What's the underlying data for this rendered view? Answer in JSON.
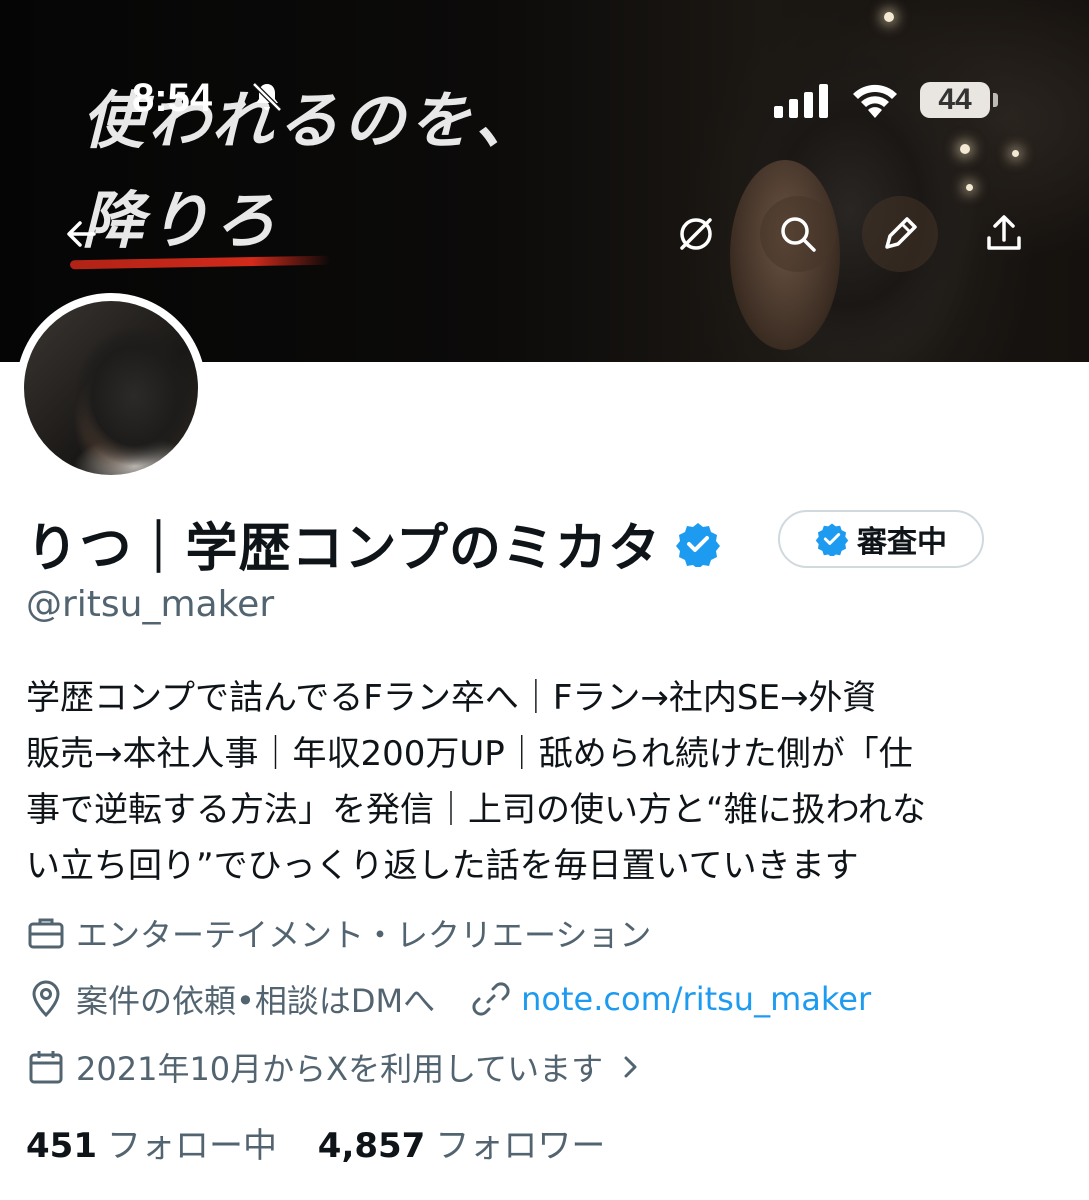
{
  "status_bar": {
    "time": "8:54",
    "battery": "44"
  },
  "banner": {
    "line1": "使われるのを、",
    "line2": "降りろ"
  },
  "profile": {
    "display_name": "りつ｜学歴コンプのミカタ",
    "review_badge": "審査中",
    "handle": "@ritsu_maker",
    "bio_lines": [
      "学歴コンプで詰んでるFラン卒へ｜Fラン→社内SE→外資",
      "販売→本社人事｜年収200万UP｜舐められ続けた側が「仕",
      "事で逆転する方法」を発信｜上司の使い方と“雑に扱われな",
      "い立ち回り”でひっくり返した話を毎日置いていきます"
    ],
    "category": "エンターテイメント・レクリエーション",
    "location": "案件の依頼•相談はDMへ",
    "website": "note.com/ritsu_maker",
    "joined": "2021年10月からXを利用しています",
    "following_count": "451",
    "following_label": "フォロー中",
    "followers_count": "4,857",
    "followers_label": "フォロワー"
  },
  "colors": {
    "accent": "#1d9bf0",
    "secondary_text": "#536471",
    "primary_text": "#0f1419"
  }
}
